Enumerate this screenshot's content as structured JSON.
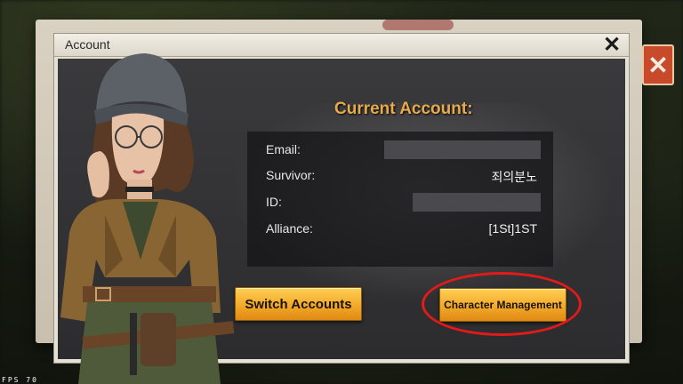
{
  "dialog": {
    "title": "Account",
    "current_account_label": "Current Account:",
    "fields": [
      {
        "label": "Email:",
        "value": "",
        "redacted": true
      },
      {
        "label": "Survivor:",
        "value": "죄의분노",
        "redacted": false
      },
      {
        "label": "ID:",
        "value": "",
        "redacted": true
      },
      {
        "label": "Alliance:",
        "value": "[1St]1ST",
        "redacted": false
      }
    ],
    "switch_button": "Switch Accounts",
    "character_button": "Character Management"
  },
  "hud": {
    "fps_label": "FPS",
    "fps_value": "70"
  },
  "colors": {
    "accent_gold": "#e7a94a",
    "button_gold": "#f2a928",
    "highlight_red": "#e21a1a",
    "outer_close_orange": "#c84a2a"
  },
  "icons": [
    "close-icon",
    "outer-close-icon"
  ]
}
